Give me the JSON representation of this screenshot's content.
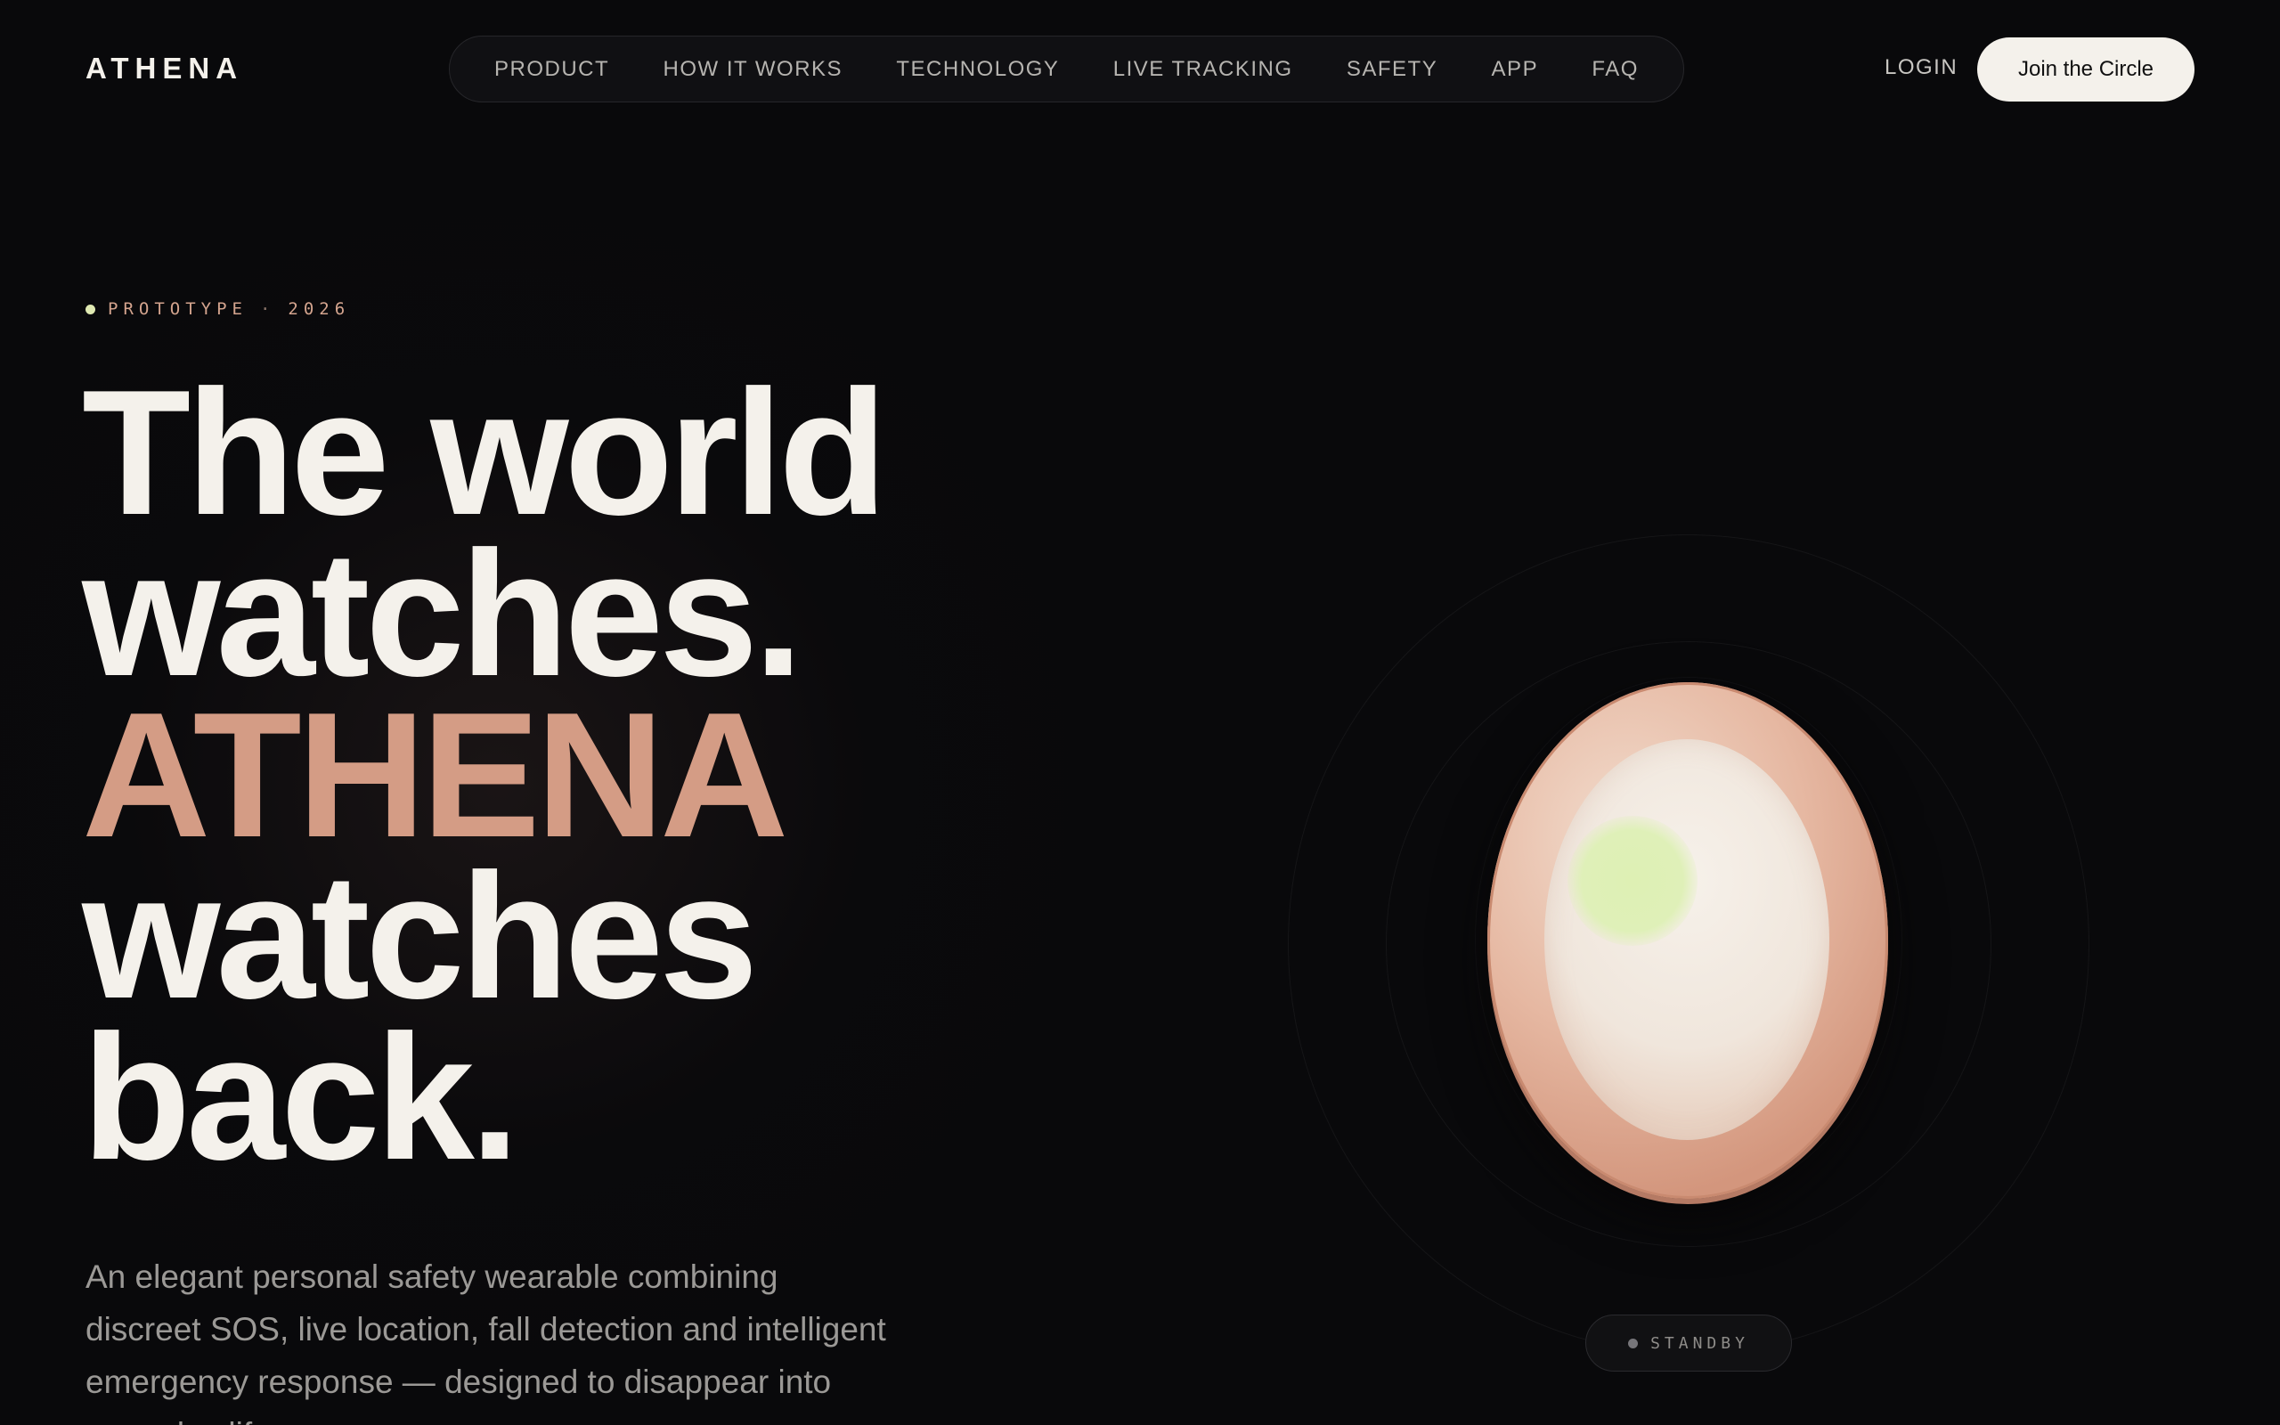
{
  "header": {
    "logo": "ATHENA",
    "nav": [
      "PRODUCT",
      "HOW IT WORKS",
      "TECHNOLOGY",
      "LIVE TRACKING",
      "SAFETY",
      "APP",
      "FAQ"
    ],
    "login": "LOGIN",
    "cta": "Join the Circle"
  },
  "hero": {
    "eyebrow_label": "PROTOTYPE",
    "eyebrow_separator": "·",
    "eyebrow_year": "2026",
    "headline": [
      "The world",
      "watches.",
      "ATHENA",
      "watches",
      "back."
    ],
    "subtext": "An elegant personal safety wearable combining discreet SOS, live location, fall detection and intelligent emergency response — designed to disappear into everyday life."
  },
  "device": {
    "status": "STANDBY",
    "led_color": "#dff0b8",
    "body_color": "#e6b8a2"
  },
  "colors": {
    "background": "#09090b",
    "accent": "#d49c85",
    "text": "#f4f1eb"
  }
}
